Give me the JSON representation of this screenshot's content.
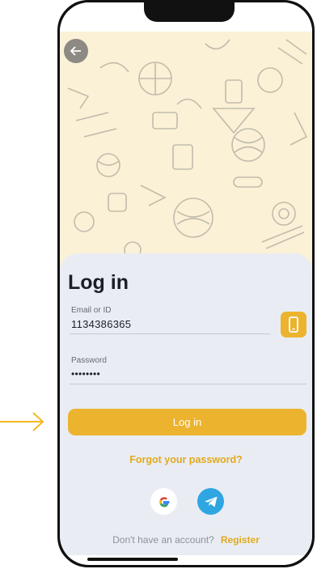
{
  "form": {
    "title": "Log in",
    "email_label": "Email or ID",
    "email_value": "1134386365",
    "password_label": "Password",
    "password_value": "••••••••",
    "login_label": "Log in",
    "forgot_label": "Forgot your password?",
    "no_account_text": "Don't have an account?",
    "register_label": "Register"
  },
  "icons": {
    "back": "arrow-left-icon",
    "phone": "mobile-phone-icon",
    "google": "google-icon",
    "telegram": "telegram-icon",
    "pointer": "arrow-right-icon"
  },
  "colors": {
    "accent": "#ecb32e",
    "accent_text": "#e2a91d",
    "background": "#e9edf3",
    "hero": "#fbf1d6",
    "telegram": "#2fa6e1"
  }
}
